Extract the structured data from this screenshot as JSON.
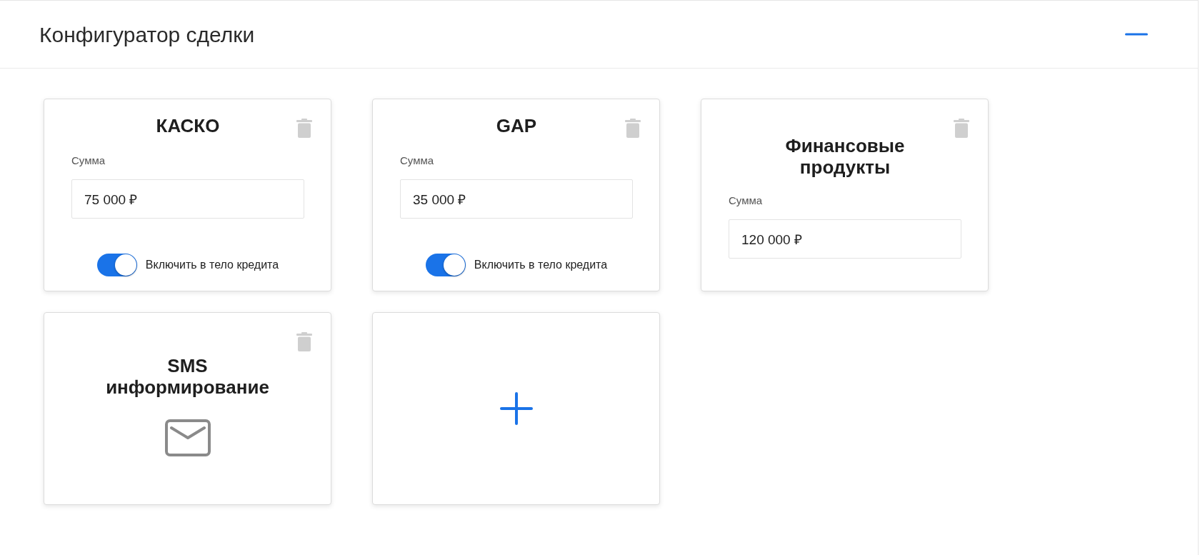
{
  "panel": {
    "title": "Конфигуратор сделки",
    "expanded": true
  },
  "cards": [
    {
      "kind": "insurance",
      "title": "КАСКО",
      "sum_label": "Сумма",
      "value": "75 000 ₽",
      "toggle": {
        "label": "Включить в тело кредита",
        "on": true
      }
    },
    {
      "kind": "insurance",
      "title": "GAP",
      "sum_label": "Сумма",
      "value": "35 000 ₽",
      "toggle": {
        "label": "Включить в тело кредита",
        "on": true
      }
    },
    {
      "kind": "product",
      "title": "Финансовые продукты",
      "sum_label": "Сумма",
      "value": "120 000 ₽"
    },
    {
      "kind": "service",
      "title": "SMS информирование"
    },
    {
      "kind": "add"
    }
  ]
}
